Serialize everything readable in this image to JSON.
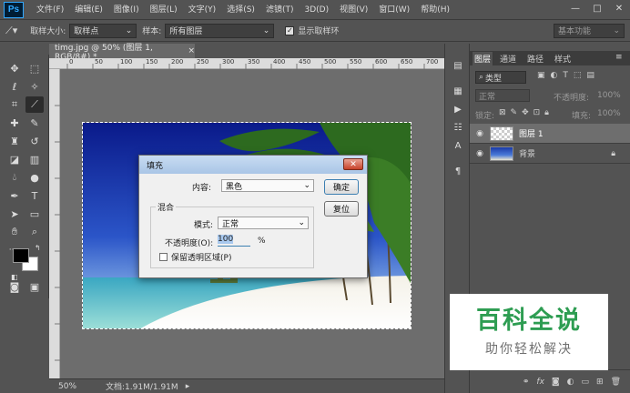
{
  "app": {
    "logo": "Ps",
    "menu": [
      "文件(F)",
      "编辑(E)",
      "图像(I)",
      "图层(L)",
      "文字(Y)",
      "选择(S)",
      "滤镜(T)",
      "3D(D)",
      "视图(V)",
      "窗口(W)",
      "帮助(H)"
    ],
    "window_buttons": [
      "—",
      "□",
      "✕"
    ]
  },
  "options": {
    "sample_size_label": "取样大小:",
    "sample_size_value": "取样点",
    "sample_label": "样本:",
    "sample_value": "所有图层",
    "show_ring_label": "显示取样环",
    "show_ring_checked": true,
    "workspace": "基本功能"
  },
  "document": {
    "tab_title": "timg.jpg @ 50% (图层 1, RGB/8#) *",
    "tab_close": "×",
    "ruler_ticks": [
      "0",
      "50",
      "100",
      "150",
      "200",
      "250",
      "300",
      "350",
      "400",
      "450",
      "500",
      "550",
      "600",
      "650",
      "700"
    ],
    "zoom": "50%",
    "doc_size": "文档:1.91M/1.91M"
  },
  "dialog": {
    "title": "填充",
    "content_label": "内容:",
    "content_value": "黑色",
    "ok": "确定",
    "reset": "复位",
    "blend_group": "混合",
    "mode_label": "模式:",
    "mode_value": "正常",
    "opacity_label": "不透明度(O):",
    "opacity_value": "100",
    "opacity_unit": "%",
    "preserve_label": "保留透明区域(P)",
    "preserve_checked": false
  },
  "layers_panel": {
    "tabs": [
      "图层",
      "通道",
      "路径",
      "样式"
    ],
    "kind_filter": "类型",
    "blend_mode": "正常",
    "opacity_label": "不透明度:",
    "opacity_value": "100%",
    "lock_label": "锁定:",
    "fill_label": "填充:",
    "fill_value": "100%",
    "layers": [
      {
        "name": "图层 1",
        "selected": true
      },
      {
        "name": "背景",
        "selected": false
      }
    ]
  },
  "watermark": {
    "main": "百科全说",
    "sub": "助你轻松解决"
  },
  "colors": {
    "accent": "#31a8ff",
    "watermark_green": "#2e9d52",
    "dialog_bg": "#f0f0f0"
  }
}
